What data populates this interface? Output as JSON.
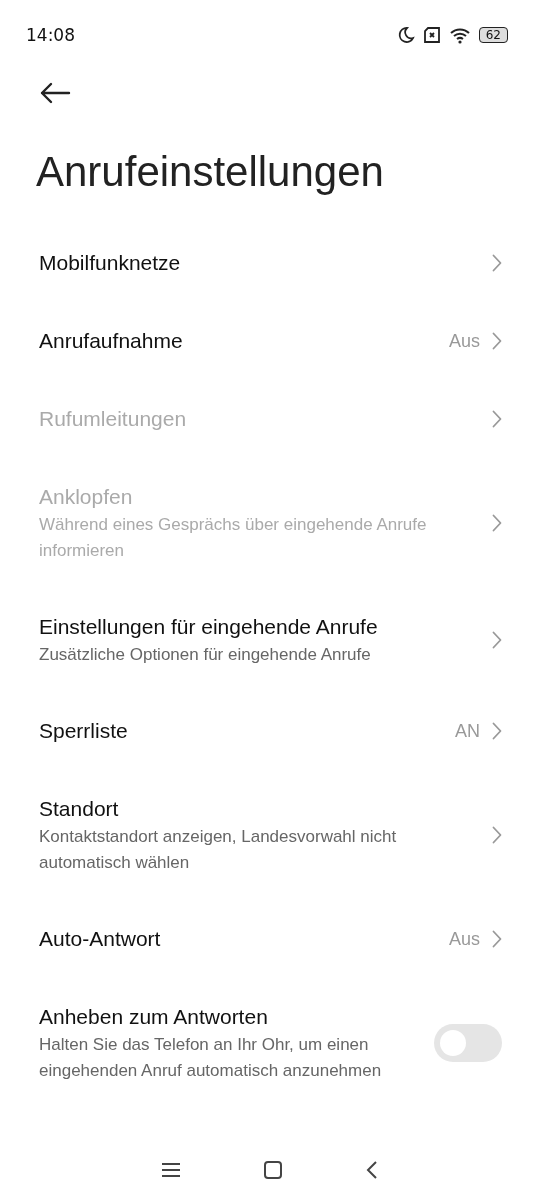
{
  "status_bar": {
    "time": "14:08",
    "battery": "62"
  },
  "title": "Anrufeinstellungen",
  "items": [
    {
      "kind": "link",
      "title": "Mobilfunknetze",
      "disabled": false
    },
    {
      "kind": "link",
      "title": "Anrufaufnahme",
      "value": "Aus",
      "disabled": false
    },
    {
      "kind": "link",
      "title": "Rufumleitungen",
      "disabled": true
    },
    {
      "kind": "link",
      "title": "Anklopfen",
      "subtitle": "Während eines Gesprächs über eingehende Anrufe informieren",
      "disabled": true
    },
    {
      "kind": "link",
      "title": "Einstellungen für eingehende Anrufe",
      "subtitle": "Zusätzliche Optionen für eingehende Anrufe",
      "disabled": false
    },
    {
      "kind": "link",
      "title": "Sperrliste",
      "value": "AN",
      "disabled": false
    },
    {
      "kind": "link",
      "title": "Standort",
      "subtitle": "Kontaktstandort anzeigen, Landesvorwahl nicht automatisch wählen",
      "disabled": false
    },
    {
      "kind": "link",
      "title": "Auto-Antwort",
      "value": "Aus",
      "disabled": false
    },
    {
      "kind": "toggle",
      "title": "Anheben zum Antworten",
      "subtitle": "Halten Sie das Telefon an Ihr Ohr, um einen eingehenden Anruf automatisch anzunehmen",
      "disabled": false,
      "on": false
    }
  ]
}
